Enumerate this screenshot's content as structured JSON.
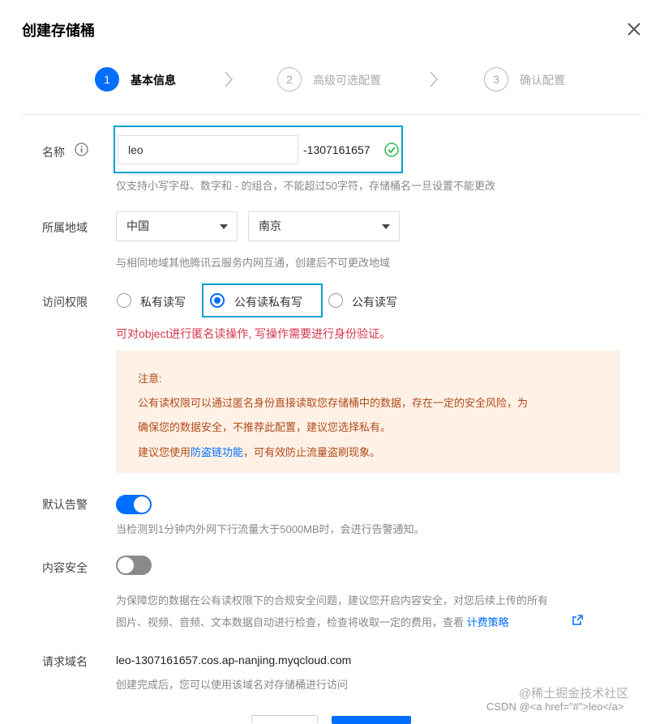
{
  "dialog": {
    "title": "创建存储桶"
  },
  "steps": [
    {
      "number": "1",
      "label": "基本信息"
    },
    {
      "number": "2",
      "label": "高级可选配置"
    },
    {
      "number": "3",
      "label": "确认配置"
    }
  ],
  "name_field": {
    "label": "名称",
    "value": "leo",
    "suffix": "-1307161657",
    "help": "仅支持小写字母、数字和 - 的组合，不能超过50字符，存储桶名一旦设置不能更改"
  },
  "region_field": {
    "label": "所属地域",
    "country": "中国",
    "city": "南京",
    "help": "与相同地域其他腾讯云服务内网互通，创建后不可更改地域"
  },
  "access_field": {
    "label": "访问权限",
    "options": [
      "私有读写",
      "公有读私有写",
      "公有读写"
    ],
    "selected": "公有读私有写",
    "warning": "可对object进行匿名读操作, 写操作需要进行身份验证。"
  },
  "notice": {
    "title": "注意:",
    "line1": "公有读权限可以通过匿名身份直接读取您存储桶中的数据，存在一定的安全风险，为",
    "line2": "确保您的数据安全，不推荐此配置，建议您选择私有。",
    "line3_prefix": "建议您使用",
    "line3_link": "防盗链功能",
    "line3_suffix": "，可有效防止流量盗刷现象。"
  },
  "alarm_field": {
    "label": "默认告警",
    "enabled": true,
    "help": "当检测到1分钟内外网下行流量大于5000MB时，会进行告警通知。"
  },
  "content_security_field": {
    "label": "内容安全",
    "enabled": false,
    "help_line1": "为保障您的数据在公有读权限下的合规安全问题，建议您开启内容安全，对您后续上传的所有",
    "help_line2": "图片、视频、音频、文本数据自动进行检查，检查将收取一定的费用，查看",
    "link": "计费策略"
  },
  "domain_field": {
    "label": "请求域名",
    "value": "leo-1307161657.cos.ap-nanjing.myqcloud.com",
    "help": "创建完成后，您可以使用该域名对存储桶进行访问"
  },
  "watermarks": {
    "juejin": "@稀土掘金技术社区",
    "csdn": "CSDN @<a href=\"#\">leo</a>"
  },
  "colors": {
    "primary": "#006eff",
    "highlight_border": "#0aa0cf",
    "danger": "#d6364b",
    "success": "#2db84d",
    "notice_bg": "#fff1e6"
  }
}
